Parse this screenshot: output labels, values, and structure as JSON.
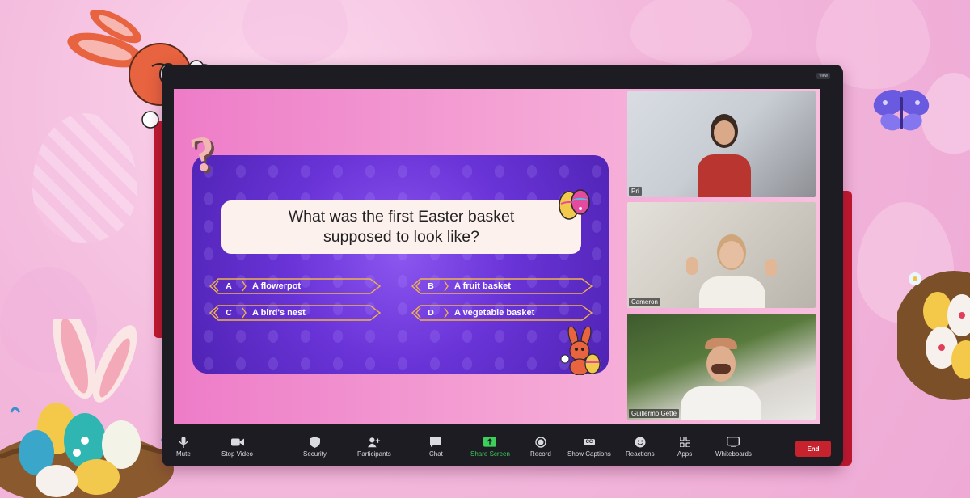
{
  "window": {
    "view_badge": "View"
  },
  "quiz": {
    "question": "What was the first Easter basket supposed to look like?",
    "question_line1": "What was the first Easter basket",
    "question_line2": "supposed to look like?",
    "answers": [
      {
        "letter": "A",
        "text": "A flowerpot"
      },
      {
        "letter": "B",
        "text": "A fruit basket"
      },
      {
        "letter": "C",
        "text": "A bird's nest"
      },
      {
        "letter": "D",
        "text": "A vegetable basket"
      }
    ]
  },
  "participants": [
    {
      "name": "Pri"
    },
    {
      "name": "Cameron"
    },
    {
      "name": "Guillermo Gette"
    }
  ],
  "toolbar": {
    "mute": "Mute",
    "stop_video": "Stop Video",
    "security": "Security",
    "participants": "Participants",
    "chat": "Chat",
    "share_screen": "Share Screen",
    "record": "Record",
    "show_captions": "Show Captions",
    "reactions": "Reactions",
    "apps": "Apps",
    "whiteboards": "Whiteboards",
    "end": "End"
  },
  "colors": {
    "accent_green": "#3ccf5a",
    "end_red": "#c7232f",
    "quiz_purple": "#6a34d8",
    "answer_gold": "#f0b24a"
  },
  "icons": {
    "captions_badge": "CC"
  }
}
